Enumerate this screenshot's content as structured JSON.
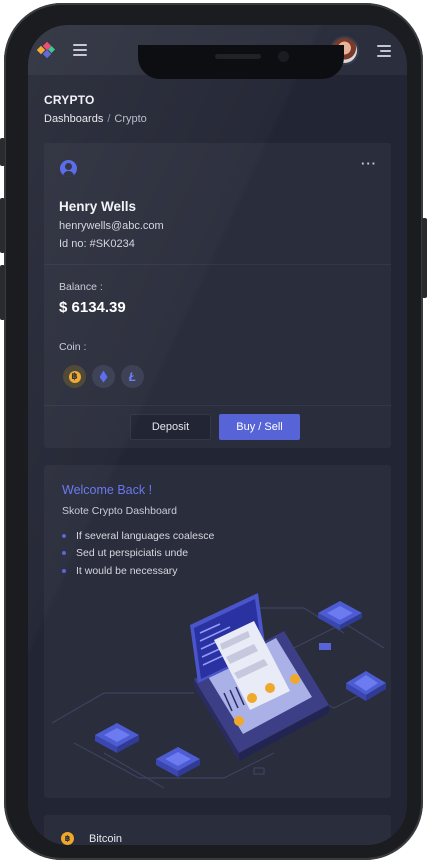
{
  "page": {
    "title": "CRYPTO"
  },
  "breadcrumb": {
    "parent": "Dashboards",
    "separator": "/",
    "current": "Crypto"
  },
  "profile": {
    "name": "Henry Wells",
    "email": "henrywells@abc.com",
    "id_text": "Id no: #SK0234",
    "menu_label": "···",
    "balance_label": "Balance :",
    "balance_value": "$ 6134.39",
    "coin_label": "Coin :",
    "coins": [
      "bitcoin-icon",
      "ethereum-icon",
      "litecoin-icon"
    ],
    "deposit_label": "Deposit",
    "buy_sell_label": "Buy / Sell"
  },
  "welcome": {
    "title": "Welcome Back !",
    "subtitle": "Skote Crypto Dashboard",
    "items": [
      "If several languages coalesce",
      "Sed ut perspiciatis unde",
      "It would be necessary"
    ]
  },
  "wallet": {
    "first_coin": "Bitcoin",
    "first_coin_symbol": "฿"
  },
  "colors": {
    "accent": "#5664d7",
    "link": "#6877f0",
    "card": "#2a2d3b",
    "bg": "#222533",
    "bitcoin": "#f0a82a"
  }
}
